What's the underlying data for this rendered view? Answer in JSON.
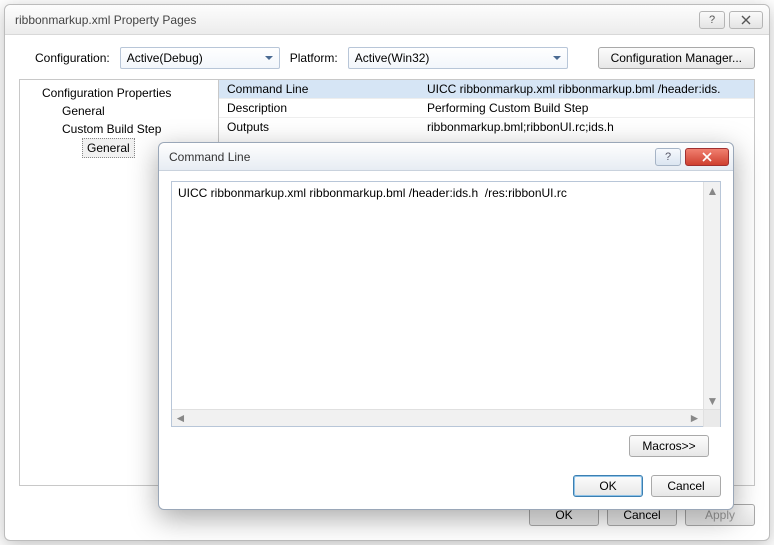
{
  "window": {
    "title": "ribbonmarkup.xml Property Pages",
    "config_label": "Configuration:",
    "config_value": "Active(Debug)",
    "platform_label": "Platform:",
    "platform_value": "Active(Win32)",
    "config_mgr_label": "Configuration Manager...",
    "ok_label": "OK",
    "cancel_label": "Cancel",
    "apply_label": "Apply"
  },
  "tree": {
    "root": "Configuration Properties",
    "items": [
      "General",
      "Custom Build Step"
    ],
    "sub_selected": "General"
  },
  "props": {
    "rows": [
      {
        "label": "Command Line",
        "value": "UICC ribbonmarkup.xml ribbonmarkup.bml /header:ids."
      },
      {
        "label": "Description",
        "value": "Performing Custom Build Step"
      },
      {
        "label": "Outputs",
        "value": "ribbonmarkup.bml;ribbonUI.rc;ids.h"
      }
    ]
  },
  "inner": {
    "title": "Command Line",
    "text": "UICC ribbonmarkup.xml ribbonmarkup.bml /header:ids.h  /res:ribbonUI.rc",
    "macros_label": "Macros>>",
    "ok_label": "OK",
    "cancel_label": "Cancel"
  }
}
